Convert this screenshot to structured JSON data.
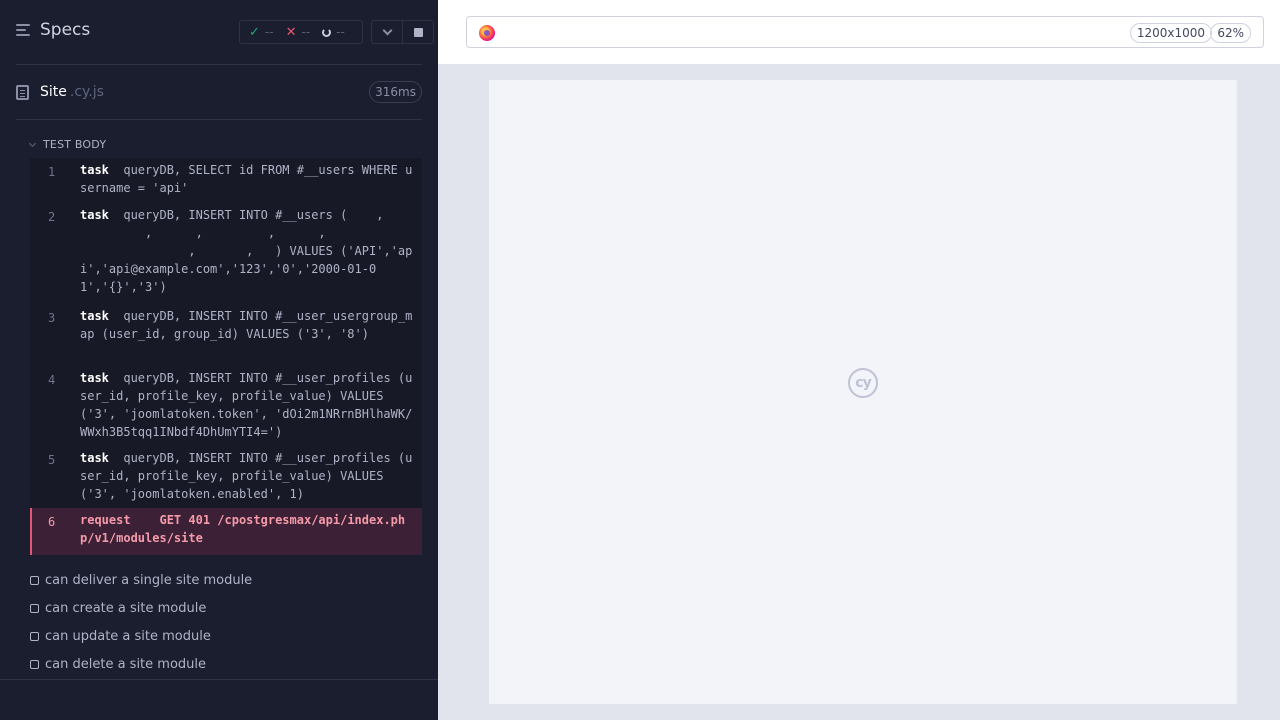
{
  "reporter": {
    "title": "Specs",
    "stats": {
      "passed": "--",
      "failed": "--",
      "pending": "--"
    },
    "spec": {
      "name": "Site",
      "ext": ".cy.js",
      "duration": "316ms"
    },
    "section_title": "TEST BODY",
    "commands": [
      {
        "num": "1",
        "name": "task",
        "message": "queryDB, SELECT id FROM #__users WHERE username = 'api'"
      },
      {
        "num": "2",
        "name": "task",
        "message": "queryDB, INSERT INTO #__users (    ,\n         ,      ,         ,      ,\n               ,       ,   ) VALUES ('API','api','api@example.com','123','0','2000-01-01','{}','3')"
      },
      {
        "num": "3",
        "name": "task",
        "message": "queryDB, INSERT INTO #__user_usergroup_map (user_id, group_id) VALUES ('3', '8')"
      },
      {
        "num": "4",
        "name": "task",
        "message": "queryDB, INSERT INTO #__user_profiles (user_id, profile_key, profile_value) VALUES ('3', 'joomlatoken.token', 'dOi2m1NRrnBHlhaWK/WWxh3B5tqq1INbdf4DhUmYTI4=')"
      },
      {
        "num": "5",
        "name": "task",
        "message": "queryDB, INSERT INTO #__user_profiles (user_id, profile_key, profile_value) VALUES ('3', 'joomlatoken.enabled', 1)"
      },
      {
        "num": "6",
        "name": "request",
        "message": "GET 401 /cpostgresmax/api/index.php/v1/modules/site"
      }
    ],
    "tests": [
      "can deliver a single site module",
      "can create a site module",
      "can update a site module",
      "can delete a site module"
    ]
  },
  "preview": {
    "browser_icon": "firefox-icon",
    "viewport_size": "1200x1000",
    "zoom": "62%",
    "placeholder_logo": "cy"
  },
  "colors": {
    "reporter_bg": "#1b1e2e",
    "error_accent": "#e45770",
    "pass": "#1fa971"
  }
}
